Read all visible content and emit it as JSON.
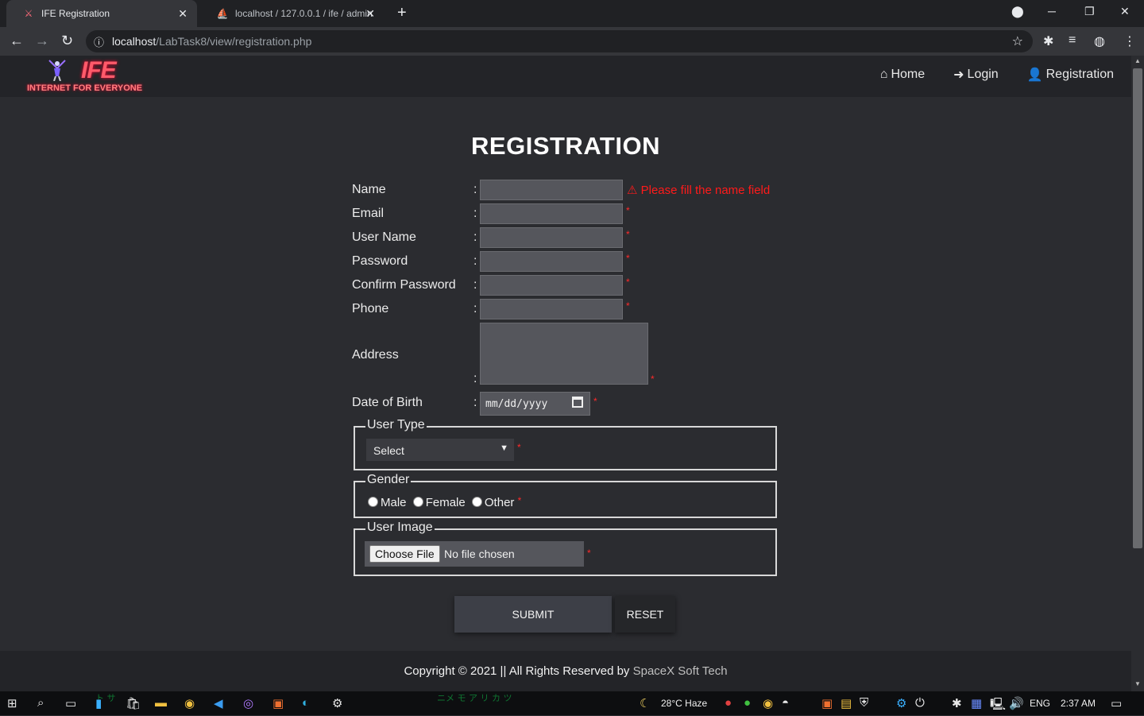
{
  "browser": {
    "tabs": [
      {
        "title": "IFE Registration",
        "active": true,
        "favicon": "ife-favicon-icon"
      },
      {
        "title": "localhost / 127.0.0.1 / ife / admin",
        "active": false,
        "favicon": "phpmyadmin-icon"
      }
    ],
    "url_host": "localhost",
    "url_path": "/LabTask8/view/registration.php"
  },
  "site": {
    "logo_text": "IFE",
    "logo_tagline": "INTERNET FOR EVERYONE",
    "nav": [
      {
        "label": "Home",
        "icon": "home-icon"
      },
      {
        "label": "Login",
        "icon": "sign-in-icon"
      },
      {
        "label": "Registration",
        "icon": "user-plus-icon"
      }
    ]
  },
  "form": {
    "title": "REGISTRATION",
    "colon": ":",
    "required_mark": "*",
    "fields": {
      "name": {
        "label": "Name",
        "error": "⚠ Please fill the name field"
      },
      "email": {
        "label": "Email"
      },
      "username": {
        "label": "User Name"
      },
      "password": {
        "label": "Password"
      },
      "confirm_password": {
        "label": "Confirm Password"
      },
      "phone": {
        "label": "Phone"
      },
      "address": {
        "label": "Address"
      },
      "dob": {
        "label": "Date of Birth",
        "placeholder": "mm/dd/yyyy"
      }
    },
    "user_type": {
      "legend": "User Type",
      "selected": "Select"
    },
    "gender": {
      "legend": "Gender",
      "options": [
        "Male",
        "Female",
        "Other"
      ]
    },
    "user_image": {
      "legend": "User Image",
      "button": "Choose File",
      "status": "No file chosen"
    },
    "submit_label": "SUBMIT",
    "reset_label": "RESET"
  },
  "footer": {
    "text": "Copyright © 2021 || All Rights Reserved by ",
    "brand": "SpaceX Soft Tech"
  },
  "taskbar": {
    "weather": "28°C  Haze",
    "language": "ENG",
    "time": "2:37 AM"
  }
}
